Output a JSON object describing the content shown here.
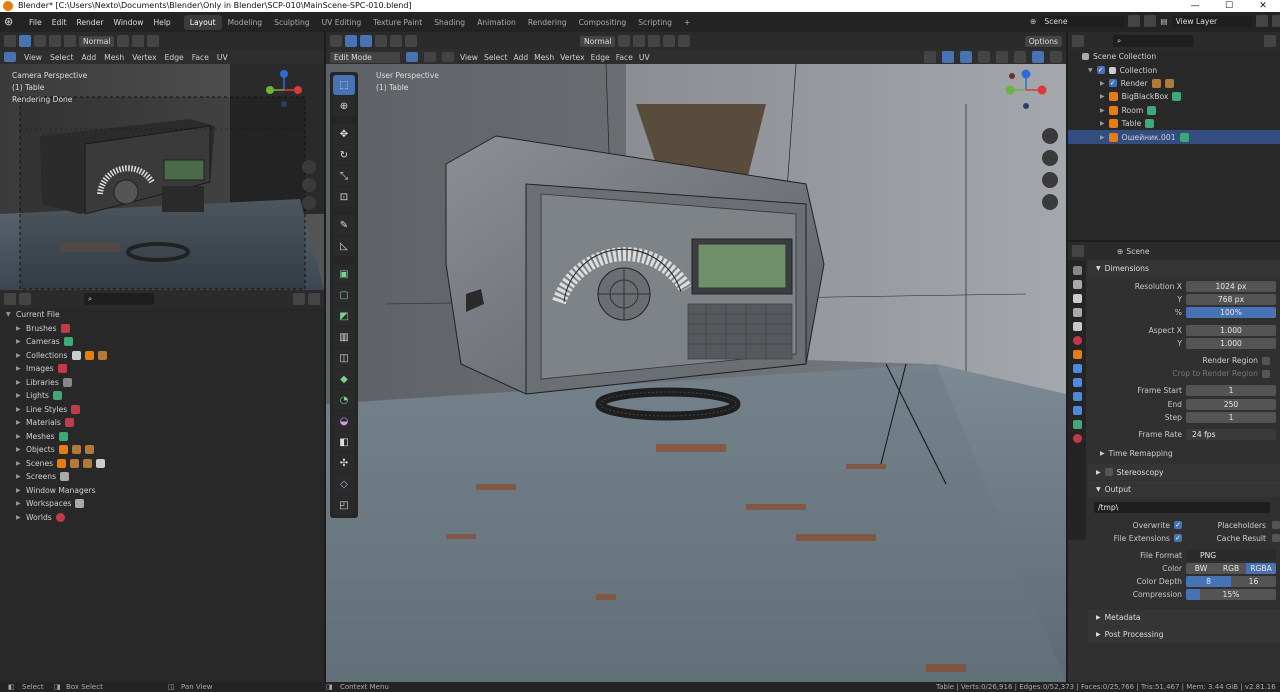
{
  "title_bar": {
    "text": "Blender* [C:\\Users\\Nexto\\Documents\\Blender\\Only in Blender\\SCP-010\\MainScene-SPC-010.blend]"
  },
  "menu": [
    "File",
    "Edit",
    "Render",
    "Window",
    "Help"
  ],
  "workspaces": [
    "Layout",
    "Modeling",
    "Sculpting",
    "UV Editing",
    "Texture Paint",
    "Shading",
    "Animation",
    "Rendering",
    "Compositing",
    "Scripting"
  ],
  "active_workspace": "Layout",
  "scene_field": "Scene",
  "view_layer_field": "View Layer",
  "left_viewport": {
    "header": [
      "View",
      "Select",
      "Add",
      "Mesh",
      "Vertex",
      "Edge",
      "Face",
      "UV"
    ],
    "transform_orientation": "Normal",
    "overlay": [
      "Camera Perspective",
      "(1) Table",
      "Rendering Done"
    ]
  },
  "main_viewport": {
    "mode": "Edit Mode",
    "header": [
      "View",
      "Select",
      "Add",
      "Mesh",
      "Vertex",
      "Edge",
      "Face",
      "UV"
    ],
    "transform_orientation": "Normal",
    "axes": [
      "X",
      "Y",
      "Z"
    ],
    "options": "Options",
    "overlay": [
      "User Perspective",
      "(1) Table"
    ]
  },
  "file_browser": {
    "root": "Current File",
    "items": [
      "Brushes",
      "Cameras",
      "Collections",
      "Images",
      "Libraries",
      "Lights",
      "Line Styles",
      "Materials",
      "Meshes",
      "Objects",
      "Scenes",
      "Screens",
      "Window Managers",
      "Workspaces",
      "Worlds"
    ]
  },
  "outliner": {
    "scene_collection": "Scene Collection",
    "collection": "Collection",
    "items": [
      "Render",
      "BigBlackBox",
      "Room",
      "Table",
      "Ошейник.001"
    ],
    "selected": "Ошейник.001"
  },
  "properties": {
    "context": "Scene",
    "dimensions": {
      "title": "Dimensions",
      "res_x_label": "Resolution X",
      "res_x": "1024 px",
      "res_y_label": "Y",
      "res_y": "768 px",
      "pct_label": "%",
      "pct": "100%",
      "aspect_x_label": "Aspect X",
      "aspect_x": "1.000",
      "aspect_y_label": "Y",
      "aspect_y": "1.000",
      "render_region": "Render Region",
      "crop": "Crop to Render Region",
      "frame_start_label": "Frame Start",
      "frame_start": "1",
      "end_label": "End",
      "end": "250",
      "step_label": "Step",
      "step": "1",
      "frame_rate_label": "Frame Rate",
      "frame_rate": "24 fps",
      "time_remap": "Time Remapping"
    },
    "stereoscopy": "Stereoscopy",
    "output": {
      "title": "Output",
      "path": "/tmp\\",
      "overwrite": "Overwrite",
      "placeholders": "Placeholders",
      "file_ext": "File Extensions",
      "cache_result": "Cache Result",
      "file_format_label": "File Format",
      "file_format": "PNG",
      "color_label": "Color",
      "color_opts": [
        "BW",
        "RGB",
        "RGBA"
      ],
      "depth_label": "Color Depth",
      "depth_opts": [
        "8",
        "16"
      ],
      "compression_label": "Compression",
      "compression": "15%",
      "compression_frac": 0.15
    },
    "metadata": "Metadata",
    "post": "Post Processing"
  },
  "status": {
    "select": "Select",
    "box_select": "Box Select",
    "pan": "Pan View",
    "context_menu": "Context Menu",
    "stats": "Table | Verts:0/26,916 | Edges:0/52,373 | Faces:0/25,766 | Tris:51,467 | Mem: 3.44 GiB | v2.81.16"
  },
  "colors": {
    "accent": "#4772b3",
    "bg": "#303030",
    "header": "#2b2b2b",
    "orange": "#e87d0d",
    "green": "#3fa878"
  }
}
